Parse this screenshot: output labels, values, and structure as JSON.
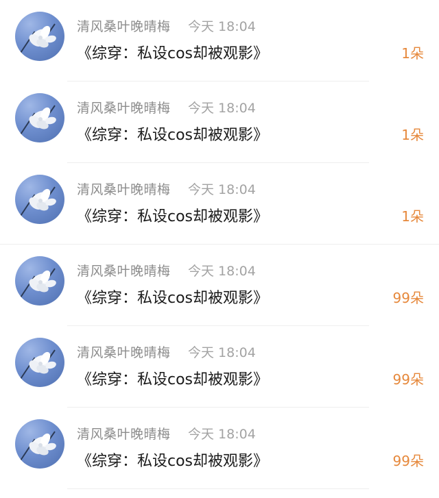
{
  "colors": {
    "author": "#8c8c8c",
    "time": "#a3a3a3",
    "title": "#1a1a1a",
    "gift": "#e6883b"
  },
  "items": [
    {
      "author": "清风桑叶晚晴梅",
      "time": "今天 18:04",
      "title": "《综穿：私设cos却被观影》",
      "gift": "1朵",
      "avatar_icon": "white-flower-avatar"
    },
    {
      "author": "清风桑叶晚晴梅",
      "time": "今天 18:04",
      "title": "《综穿：私设cos却被观影》",
      "gift": "1朵",
      "avatar_icon": "white-flower-avatar"
    },
    {
      "author": "清风桑叶晚晴梅",
      "time": "今天 18:04",
      "title": "《综穿：私设cos却被观影》",
      "gift": "1朵",
      "avatar_icon": "white-flower-avatar"
    },
    {
      "author": "清风桑叶晚晴梅",
      "time": "今天 18:04",
      "title": "《综穿：私设cos却被观影》",
      "gift": "99朵",
      "avatar_icon": "white-flower-avatar"
    },
    {
      "author": "清风桑叶晚晴梅",
      "time": "今天 18:04",
      "title": "《综穿：私设cos却被观影》",
      "gift": "99朵",
      "avatar_icon": "white-flower-avatar"
    },
    {
      "author": "清风桑叶晚晴梅",
      "time": "今天 18:04",
      "title": "《综穿：私设cos却被观影》",
      "gift": "99朵",
      "avatar_icon": "white-flower-avatar"
    }
  ]
}
